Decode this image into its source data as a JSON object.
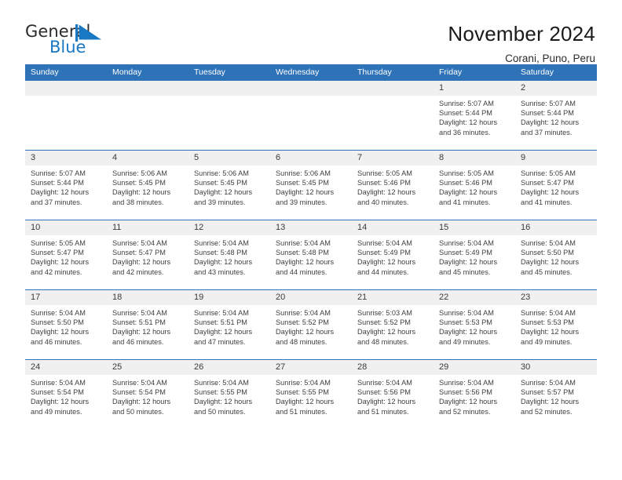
{
  "logo": {
    "word_one": "General",
    "word_two": "Blue",
    "mark": "blue-triangle-flag",
    "color_dark": "#2b2b2b",
    "color_blue": "#1878c4"
  },
  "header": {
    "title": "November 2024",
    "location": "Corani, Puno, Peru"
  },
  "theme": {
    "header_blue": "#2e72b8",
    "day_band_gray": "#f0f0f0",
    "text": "#3f3f3f"
  },
  "calendar": {
    "weekday_headers": [
      "Sunday",
      "Monday",
      "Tuesday",
      "Wednesday",
      "Thursday",
      "Friday",
      "Saturday"
    ],
    "weeks": [
      [
        {
          "day": "",
          "sunrise": "",
          "sunset": "",
          "daylight": ""
        },
        {
          "day": "",
          "sunrise": "",
          "sunset": "",
          "daylight": ""
        },
        {
          "day": "",
          "sunrise": "",
          "sunset": "",
          "daylight": ""
        },
        {
          "day": "",
          "sunrise": "",
          "sunset": "",
          "daylight": ""
        },
        {
          "day": "",
          "sunrise": "",
          "sunset": "",
          "daylight": ""
        },
        {
          "day": "1",
          "sunrise": "Sunrise: 5:07 AM",
          "sunset": "Sunset: 5:44 PM",
          "daylight": "Daylight: 12 hours and 36 minutes."
        },
        {
          "day": "2",
          "sunrise": "Sunrise: 5:07 AM",
          "sunset": "Sunset: 5:44 PM",
          "daylight": "Daylight: 12 hours and 37 minutes."
        }
      ],
      [
        {
          "day": "3",
          "sunrise": "Sunrise: 5:07 AM",
          "sunset": "Sunset: 5:44 PM",
          "daylight": "Daylight: 12 hours and 37 minutes."
        },
        {
          "day": "4",
          "sunrise": "Sunrise: 5:06 AM",
          "sunset": "Sunset: 5:45 PM",
          "daylight": "Daylight: 12 hours and 38 minutes."
        },
        {
          "day": "5",
          "sunrise": "Sunrise: 5:06 AM",
          "sunset": "Sunset: 5:45 PM",
          "daylight": "Daylight: 12 hours and 39 minutes."
        },
        {
          "day": "6",
          "sunrise": "Sunrise: 5:06 AM",
          "sunset": "Sunset: 5:45 PM",
          "daylight": "Daylight: 12 hours and 39 minutes."
        },
        {
          "day": "7",
          "sunrise": "Sunrise: 5:05 AM",
          "sunset": "Sunset: 5:46 PM",
          "daylight": "Daylight: 12 hours and 40 minutes."
        },
        {
          "day": "8",
          "sunrise": "Sunrise: 5:05 AM",
          "sunset": "Sunset: 5:46 PM",
          "daylight": "Daylight: 12 hours and 41 minutes."
        },
        {
          "day": "9",
          "sunrise": "Sunrise: 5:05 AM",
          "sunset": "Sunset: 5:47 PM",
          "daylight": "Daylight: 12 hours and 41 minutes."
        }
      ],
      [
        {
          "day": "10",
          "sunrise": "Sunrise: 5:05 AM",
          "sunset": "Sunset: 5:47 PM",
          "daylight": "Daylight: 12 hours and 42 minutes."
        },
        {
          "day": "11",
          "sunrise": "Sunrise: 5:04 AM",
          "sunset": "Sunset: 5:47 PM",
          "daylight": "Daylight: 12 hours and 42 minutes."
        },
        {
          "day": "12",
          "sunrise": "Sunrise: 5:04 AM",
          "sunset": "Sunset: 5:48 PM",
          "daylight": "Daylight: 12 hours and 43 minutes."
        },
        {
          "day": "13",
          "sunrise": "Sunrise: 5:04 AM",
          "sunset": "Sunset: 5:48 PM",
          "daylight": "Daylight: 12 hours and 44 minutes."
        },
        {
          "day": "14",
          "sunrise": "Sunrise: 5:04 AM",
          "sunset": "Sunset: 5:49 PM",
          "daylight": "Daylight: 12 hours and 44 minutes."
        },
        {
          "day": "15",
          "sunrise": "Sunrise: 5:04 AM",
          "sunset": "Sunset: 5:49 PM",
          "daylight": "Daylight: 12 hours and 45 minutes."
        },
        {
          "day": "16",
          "sunrise": "Sunrise: 5:04 AM",
          "sunset": "Sunset: 5:50 PM",
          "daylight": "Daylight: 12 hours and 45 minutes."
        }
      ],
      [
        {
          "day": "17",
          "sunrise": "Sunrise: 5:04 AM",
          "sunset": "Sunset: 5:50 PM",
          "daylight": "Daylight: 12 hours and 46 minutes."
        },
        {
          "day": "18",
          "sunrise": "Sunrise: 5:04 AM",
          "sunset": "Sunset: 5:51 PM",
          "daylight": "Daylight: 12 hours and 46 minutes."
        },
        {
          "day": "19",
          "sunrise": "Sunrise: 5:04 AM",
          "sunset": "Sunset: 5:51 PM",
          "daylight": "Daylight: 12 hours and 47 minutes."
        },
        {
          "day": "20",
          "sunrise": "Sunrise: 5:04 AM",
          "sunset": "Sunset: 5:52 PM",
          "daylight": "Daylight: 12 hours and 48 minutes."
        },
        {
          "day": "21",
          "sunrise": "Sunrise: 5:03 AM",
          "sunset": "Sunset: 5:52 PM",
          "daylight": "Daylight: 12 hours and 48 minutes."
        },
        {
          "day": "22",
          "sunrise": "Sunrise: 5:04 AM",
          "sunset": "Sunset: 5:53 PM",
          "daylight": "Daylight: 12 hours and 49 minutes."
        },
        {
          "day": "23",
          "sunrise": "Sunrise: 5:04 AM",
          "sunset": "Sunset: 5:53 PM",
          "daylight": "Daylight: 12 hours and 49 minutes."
        }
      ],
      [
        {
          "day": "24",
          "sunrise": "Sunrise: 5:04 AM",
          "sunset": "Sunset: 5:54 PM",
          "daylight": "Daylight: 12 hours and 49 minutes."
        },
        {
          "day": "25",
          "sunrise": "Sunrise: 5:04 AM",
          "sunset": "Sunset: 5:54 PM",
          "daylight": "Daylight: 12 hours and 50 minutes."
        },
        {
          "day": "26",
          "sunrise": "Sunrise: 5:04 AM",
          "sunset": "Sunset: 5:55 PM",
          "daylight": "Daylight: 12 hours and 50 minutes."
        },
        {
          "day": "27",
          "sunrise": "Sunrise: 5:04 AM",
          "sunset": "Sunset: 5:55 PM",
          "daylight": "Daylight: 12 hours and 51 minutes."
        },
        {
          "day": "28",
          "sunrise": "Sunrise: 5:04 AM",
          "sunset": "Sunset: 5:56 PM",
          "daylight": "Daylight: 12 hours and 51 minutes."
        },
        {
          "day": "29",
          "sunrise": "Sunrise: 5:04 AM",
          "sunset": "Sunset: 5:56 PM",
          "daylight": "Daylight: 12 hours and 52 minutes."
        },
        {
          "day": "30",
          "sunrise": "Sunrise: 5:04 AM",
          "sunset": "Sunset: 5:57 PM",
          "daylight": "Daylight: 12 hours and 52 minutes."
        }
      ]
    ]
  }
}
